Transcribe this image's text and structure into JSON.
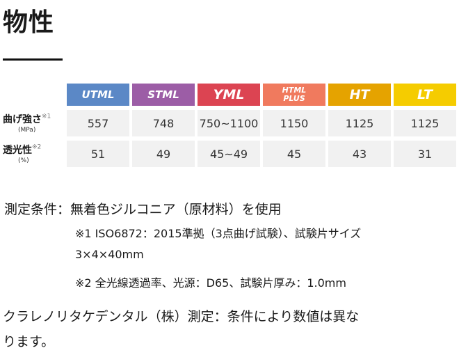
{
  "title": "物性",
  "table": {
    "grades": [
      {
        "label": "UTML",
        "color": "#5b88c6"
      },
      {
        "label": "STML",
        "color": "#9c5da6"
      },
      {
        "label": "YML",
        "color": "#dc4452"
      },
      {
        "label": "HTML PLUS",
        "color": "#f07a5e"
      },
      {
        "label": "HT",
        "color": "#e5a300"
      },
      {
        "label": "LT",
        "color": "#f5cc00"
      }
    ],
    "rows": [
      {
        "label": "曲げ強さ",
        "note_mark": "※1",
        "unit": "(MPa)",
        "values": [
          "557",
          "748",
          "750~1100",
          "1150",
          "1125",
          "1125"
        ]
      },
      {
        "label": "透光性",
        "note_mark": "※2",
        "unit": "(%)",
        "values": [
          "51",
          "49",
          "45~49",
          "45",
          "43",
          "31"
        ]
      }
    ]
  },
  "notes": {
    "main": "測定条件：無着色ジルコニア（原材料）を使用",
    "sub1_line1": "※1 ISO6872：2015準拠（3点曲げ試験）、試験片サイズ",
    "sub1_line2": "3×4×40mm",
    "sub2": "※2 全光線透過率、光源：D65、試験片厚み：1.0mm",
    "para_line1": "クラレノリタケデンタル（株）測定：条件により数値は異な",
    "para_line2": "ります。"
  }
}
